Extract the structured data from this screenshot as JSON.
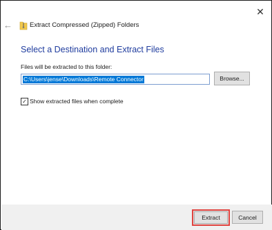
{
  "window": {
    "title": "Extract Compressed (Zipped) Folders",
    "close_glyph": "✕",
    "back_glyph": "←"
  },
  "dialog": {
    "heading": "Select a Destination and Extract Files",
    "field_label": "Files will be extracted to this folder:",
    "path_value": "C:\\Users\\jense\\Downloads\\Remote Connector",
    "browse_label": "Browse...",
    "checkbox_label": "Show extracted files when complete",
    "checkbox_checked": true,
    "checkbox_glyph": "✓"
  },
  "footer": {
    "extract_label": "Extract",
    "cancel_label": "Cancel"
  },
  "colors": {
    "heading": "#1f3c9e",
    "selection": "#0078d7",
    "highlight_outline": "#e0433f",
    "footer_bg": "#f0f0f0"
  },
  "icons": {
    "back": "back-arrow-icon",
    "folder": "zipped-folder-icon",
    "close": "close-icon",
    "check": "checkmark-icon"
  }
}
